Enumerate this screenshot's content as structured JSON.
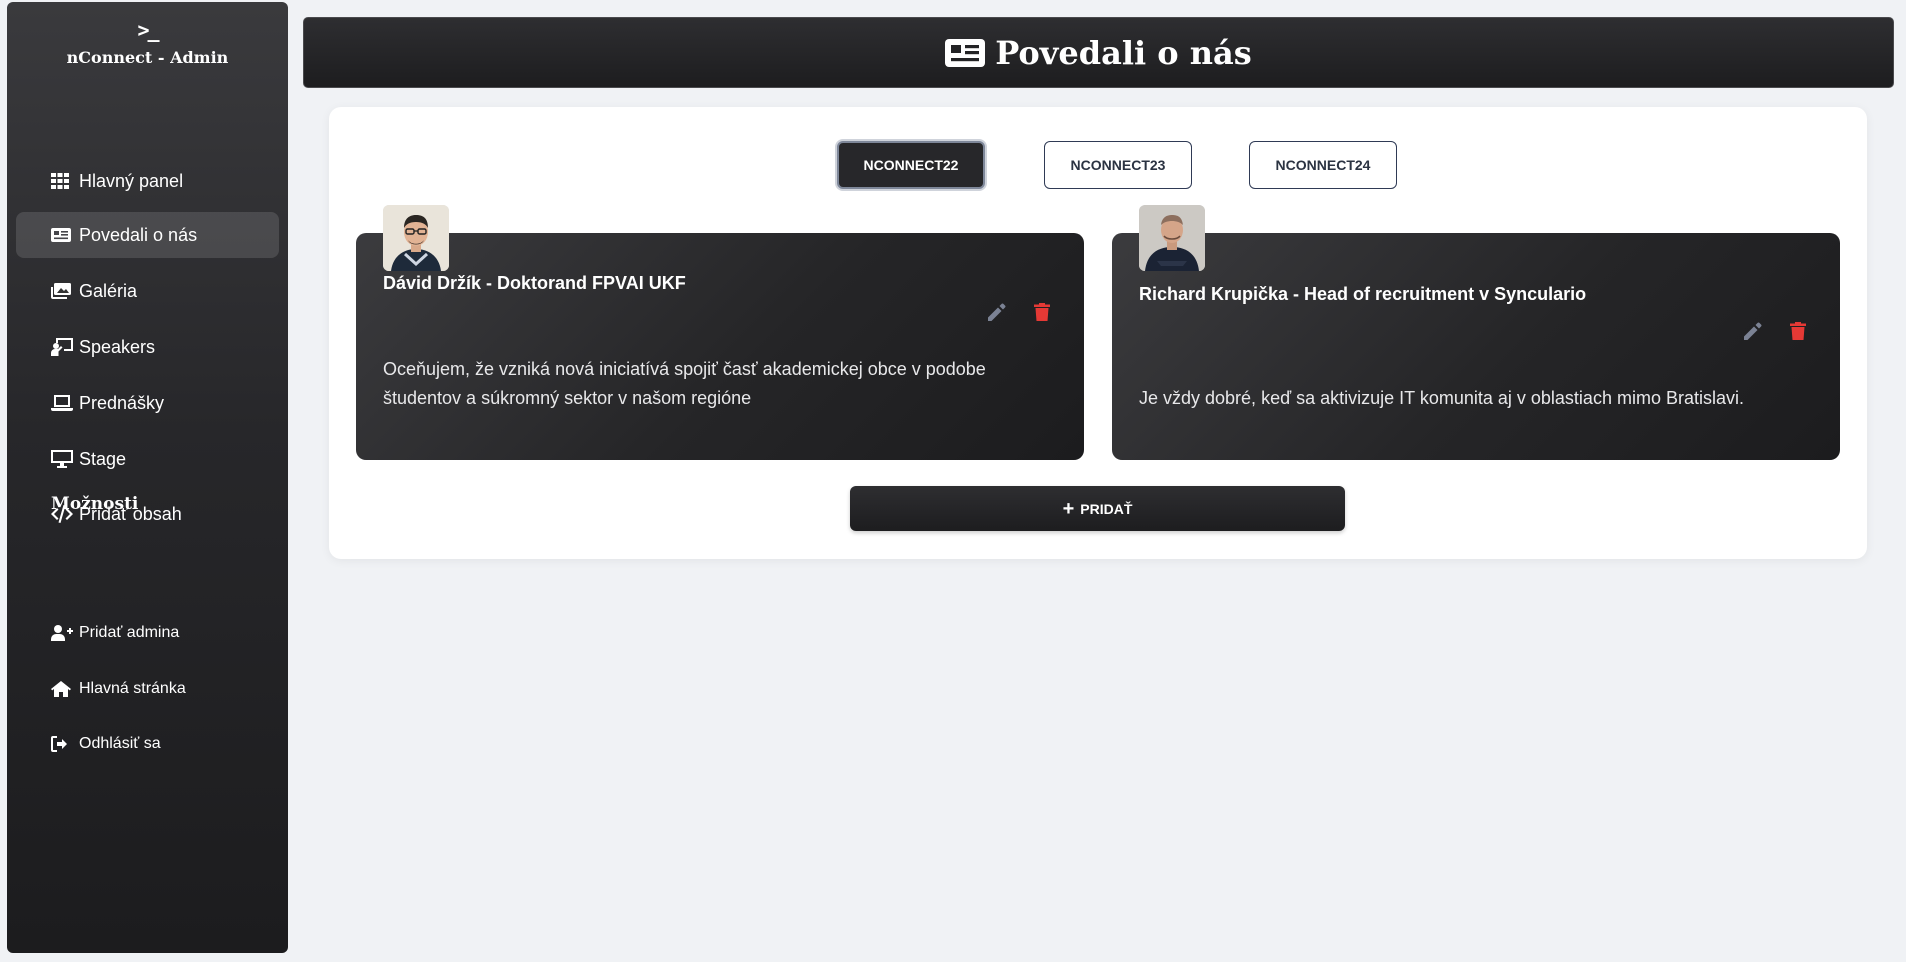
{
  "sidebar": {
    "brand_icon": ">_",
    "brand_title": "nConnect - Admin",
    "items": [
      {
        "label": "Hlavný panel",
        "icon": "grid-icon"
      },
      {
        "label": "Povedali o nás",
        "icon": "newspaper-icon",
        "active": true
      },
      {
        "label": "Galéria",
        "icon": "images-icon"
      },
      {
        "label": "Speakers",
        "icon": "chalkboard-teacher-icon"
      },
      {
        "label": "Prednášky",
        "icon": "laptop-icon"
      },
      {
        "label": "Stage",
        "icon": "desktop-icon"
      },
      {
        "label": "Pridať obsah",
        "icon": "code-icon"
      }
    ],
    "section_title": "Možnosti",
    "options": [
      {
        "label": "Pridať admina",
        "icon": "user-plus-icon"
      },
      {
        "label": "Hlavná stránka",
        "icon": "home-icon"
      },
      {
        "label": "Odhlásiť sa",
        "icon": "sign-out-icon"
      }
    ]
  },
  "header": {
    "title": "Povedali o nás",
    "icon": "newspaper-icon"
  },
  "tabs": [
    {
      "label": "NCONNECT22",
      "active": true
    },
    {
      "label": "NCONNECT23",
      "active": false
    },
    {
      "label": "NCONNECT24",
      "active": false
    }
  ],
  "testimonials": [
    {
      "name": "Dávid Držík - Doktorand FPVAI UKF",
      "quote": "Oceňujem, že vzniká nová iniciatívá spojiť časť akademickej obce v podobe študentov a súkromný sektor v našom regióne"
    },
    {
      "name": "Richard Krupička - Head of recruitment v Synculario",
      "quote": "Je vždy dobré, keď sa aktivizuje IT komunita aj v oblastiach mimo Bratislavi."
    }
  ],
  "add_button": {
    "label": "PRIDAŤ",
    "icon": "plus-icon"
  },
  "colors": {
    "edit_icon": "#7b8294",
    "delete_icon": "#e53935",
    "background": "#f0f2f5",
    "dark": "#27272a"
  }
}
